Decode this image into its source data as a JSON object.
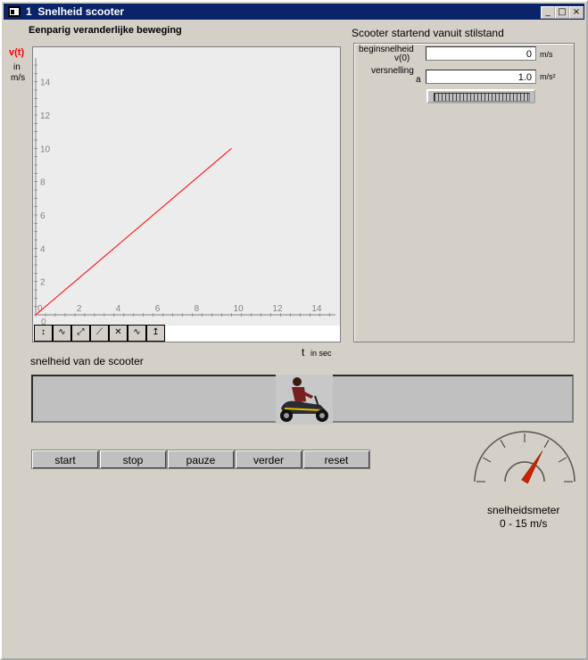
{
  "window": {
    "title_number": "1",
    "title": "Snelheid scooter",
    "controls": {
      "minimize": "_",
      "maximize": "□",
      "close": "×"
    }
  },
  "graph": {
    "heading": "Eenparig veranderlijke beweging",
    "y_symbol": "v(t)",
    "y_unit_1": "in",
    "y_unit_2": "m/s",
    "x_symbol": "t",
    "x_unit": "in sec",
    "origin_label": "0",
    "tool_icons": [
      "select-tool-icon",
      "zoom-tool-icon",
      "fit-tool-icon",
      "trace-tool-icon",
      "crosshair-tool-icon",
      "smooth-tool-icon",
      "axes-tool-icon"
    ]
  },
  "chart_data": {
    "type": "line",
    "x": [
      0,
      10
    ],
    "series": [
      {
        "values": [
          0,
          10
        ]
      }
    ],
    "xlim": [
      0,
      15
    ],
    "ylim": [
      0,
      15
    ],
    "xticks": [
      0,
      2,
      4,
      6,
      8,
      10,
      12,
      14
    ],
    "yticks": [
      2,
      4,
      6,
      8,
      10,
      12,
      14
    ],
    "xlabel": "t in sec",
    "ylabel": "v(t) in m/s",
    "line_color": "#ff0000",
    "grid": false
  },
  "panel": {
    "heading": "Scooter startend vanuit stilstand",
    "v0_label_1": "beginsnelheid",
    "v0_label_2": "v(0)",
    "v0_value": "0",
    "v0_unit": "m/s",
    "a_label_1": "versnelling",
    "a_label_2": "a",
    "a_value": "1.0",
    "a_unit": "m/s²"
  },
  "animation": {
    "label": "snelheid van de scooter"
  },
  "buttons": {
    "start": "start",
    "stop": "stop",
    "pauze": "pauze",
    "verder": "verder",
    "reset": "reset"
  },
  "speedometer": {
    "label": "snelheidsmeter",
    "range": "0 - 15 m/s",
    "value": 10,
    "max": 15
  }
}
